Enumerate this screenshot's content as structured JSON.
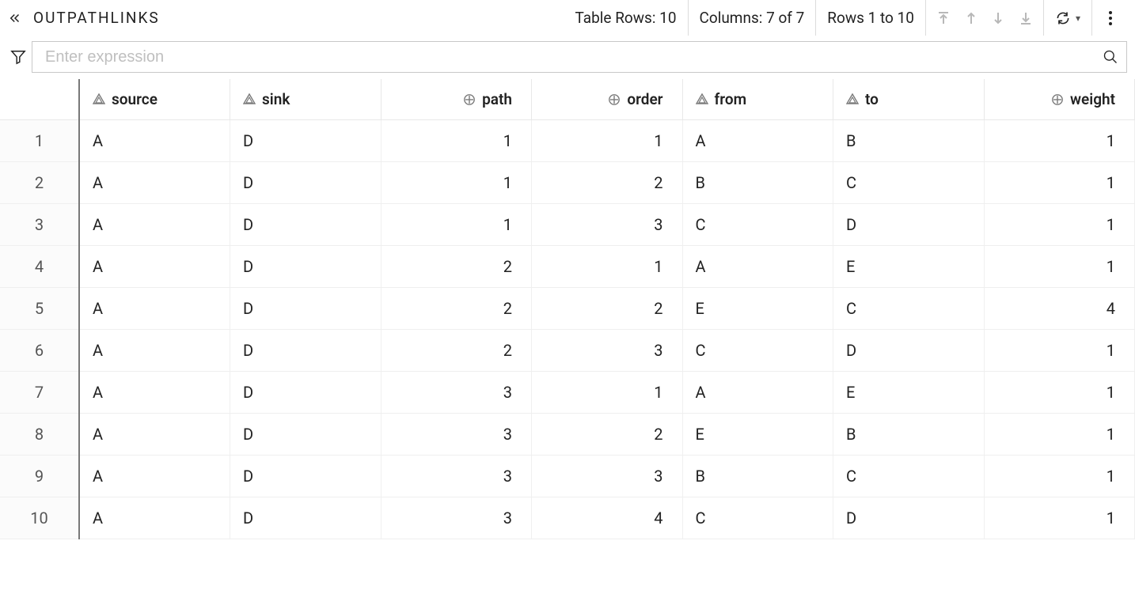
{
  "toolbar": {
    "title": "OUTPATHLINKS",
    "rows_info": "Table Rows: 10",
    "columns_info": "Columns: 7 of 7",
    "range_info": "Rows 1 to 10"
  },
  "filter": {
    "placeholder": "Enter expression"
  },
  "table": {
    "columns": [
      {
        "name": "source",
        "type": "text"
      },
      {
        "name": "sink",
        "type": "text"
      },
      {
        "name": "path",
        "type": "num"
      },
      {
        "name": "order",
        "type": "num"
      },
      {
        "name": "from",
        "type": "text"
      },
      {
        "name": "to",
        "type": "text"
      },
      {
        "name": "weight",
        "type": "num"
      }
    ],
    "rows": [
      {
        "source": "A",
        "sink": "D",
        "path": 1,
        "order": 1,
        "from": "A",
        "to": "B",
        "weight": 1
      },
      {
        "source": "A",
        "sink": "D",
        "path": 1,
        "order": 2,
        "from": "B",
        "to": "C",
        "weight": 1
      },
      {
        "source": "A",
        "sink": "D",
        "path": 1,
        "order": 3,
        "from": "C",
        "to": "D",
        "weight": 1
      },
      {
        "source": "A",
        "sink": "D",
        "path": 2,
        "order": 1,
        "from": "A",
        "to": "E",
        "weight": 1
      },
      {
        "source": "A",
        "sink": "D",
        "path": 2,
        "order": 2,
        "from": "E",
        "to": "C",
        "weight": 4
      },
      {
        "source": "A",
        "sink": "D",
        "path": 2,
        "order": 3,
        "from": "C",
        "to": "D",
        "weight": 1
      },
      {
        "source": "A",
        "sink": "D",
        "path": 3,
        "order": 1,
        "from": "A",
        "to": "E",
        "weight": 1
      },
      {
        "source": "A",
        "sink": "D",
        "path": 3,
        "order": 2,
        "from": "E",
        "to": "B",
        "weight": 1
      },
      {
        "source": "A",
        "sink": "D",
        "path": 3,
        "order": 3,
        "from": "B",
        "to": "C",
        "weight": 1
      },
      {
        "source": "A",
        "sink": "D",
        "path": 3,
        "order": 4,
        "from": "C",
        "to": "D",
        "weight": 1
      }
    ]
  }
}
